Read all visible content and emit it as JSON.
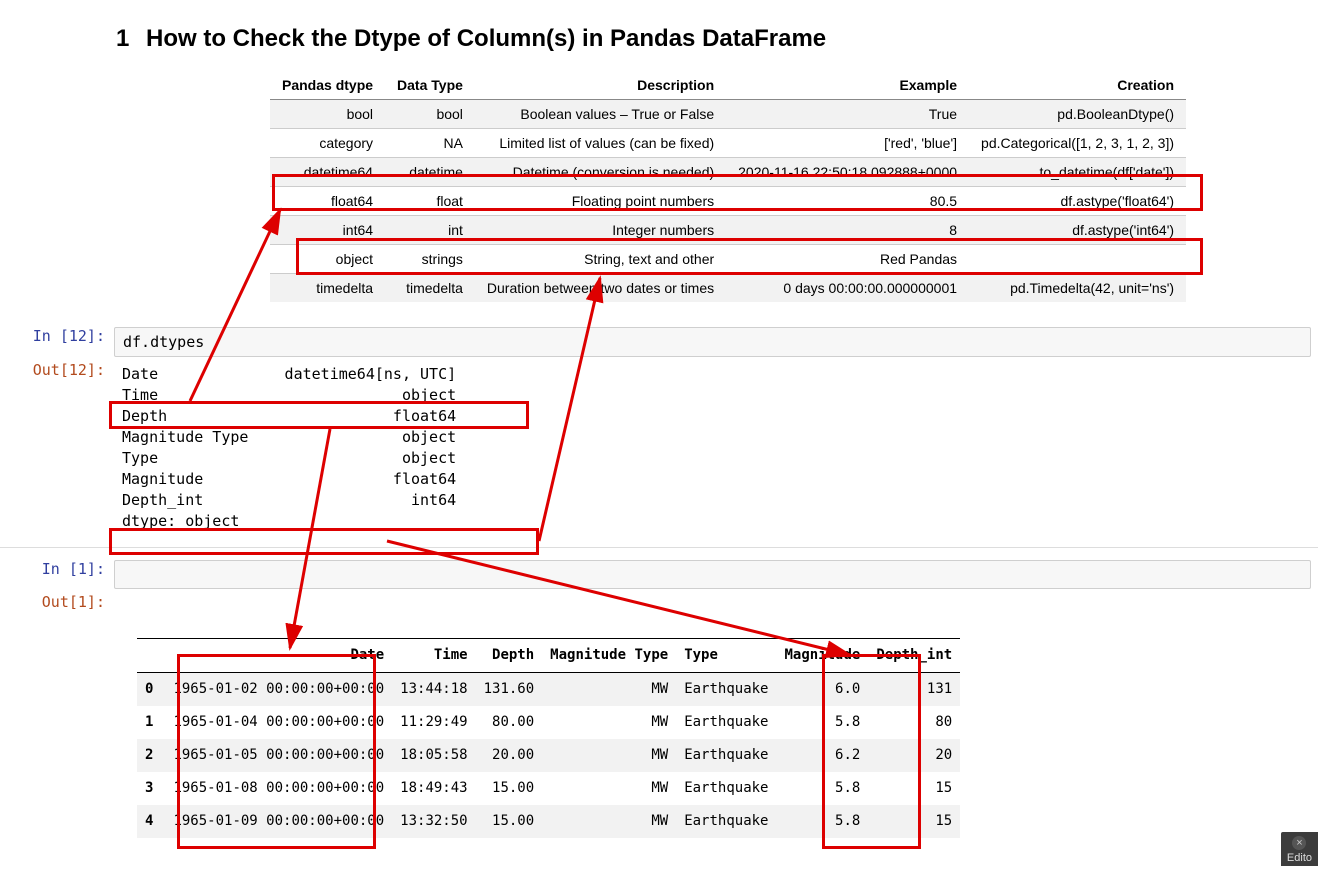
{
  "heading": {
    "number": "1",
    "text": "How to Check the Dtype of Column(s) in Pandas DataFrame"
  },
  "dtype_table": {
    "headers": [
      "Pandas dtype",
      "Data Type",
      "Description",
      "Example",
      "Creation"
    ],
    "rows": [
      {
        "pd": "bool",
        "dt": "bool",
        "desc": "Boolean values – True or False",
        "ex": "True",
        "cr": "pd.BooleanDtype()"
      },
      {
        "pd": "category",
        "dt": "NA",
        "desc": "Limited list of values (can be fixed)",
        "ex": "['red', 'blue']",
        "cr": "pd.Categorical([1, 2, 3, 1, 2, 3])"
      },
      {
        "pd": "datetime64",
        "dt": "datetime",
        "desc": "Datetime (conversion is needed)",
        "ex": "2020-11-16 22:50:18.092888+0000",
        "cr": "to_datetime(df['date'])"
      },
      {
        "pd": "float64",
        "dt": "float",
        "desc": "Floating point numbers",
        "ex": "80.5",
        "cr": "df.astype('float64')"
      },
      {
        "pd": "int64",
        "dt": "int",
        "desc": "Integer numbers",
        "ex": "8",
        "cr": "df.astype('int64')"
      },
      {
        "pd": "object",
        "dt": "strings",
        "desc": "String, text and other",
        "ex": "Red Pandas",
        "cr": ""
      },
      {
        "pd": "timedelta",
        "dt": "timedelta",
        "desc": "Duration between two dates or times",
        "ex": "0 days 00:00:00.000000001",
        "cr": "pd.Timedelta(42, unit='ns')"
      }
    ]
  },
  "cell12": {
    "in_prompt": "In [12]:",
    "code": "df.dtypes",
    "out_prompt": "Out[12]:",
    "output": "Date              datetime64[ns, UTC]\nTime                           object\nDepth                         float64\nMagnitude Type                 object\nType                           object\nMagnitude                     float64\nDepth_int                       int64\ndtype: object"
  },
  "cell1": {
    "in_prompt": "In [1]:",
    "out_prompt": "Out[1]:",
    "df_headers": [
      "",
      "Date",
      "Time",
      "Depth",
      "Magnitude Type",
      "Type",
      "Magnitude",
      "Depth_int"
    ],
    "rows": [
      {
        "idx": "0",
        "date": "1965-01-02 00:00:00+00:00",
        "time": "13:44:18",
        "depth": "131.60",
        "mt": "MW",
        "type": "Earthquake",
        "mag": "6.0",
        "di": "131"
      },
      {
        "idx": "1",
        "date": "1965-01-04 00:00:00+00:00",
        "time": "11:29:49",
        "depth": "80.00",
        "mt": "MW",
        "type": "Earthquake",
        "mag": "5.8",
        "di": "80"
      },
      {
        "idx": "2",
        "date": "1965-01-05 00:00:00+00:00",
        "time": "18:05:58",
        "depth": "20.00",
        "mt": "MW",
        "type": "Earthquake",
        "mag": "6.2",
        "di": "20"
      },
      {
        "idx": "3",
        "date": "1965-01-08 00:00:00+00:00",
        "time": "18:49:43",
        "depth": "15.00",
        "mt": "MW",
        "type": "Earthquake",
        "mag": "5.8",
        "di": "15"
      },
      {
        "idx": "4",
        "date": "1965-01-09 00:00:00+00:00",
        "time": "13:32:50",
        "depth": "15.00",
        "mt": "MW",
        "type": "Earthquake",
        "mag": "5.8",
        "di": "15"
      }
    ]
  },
  "editor_tab": {
    "label": "Edito"
  }
}
